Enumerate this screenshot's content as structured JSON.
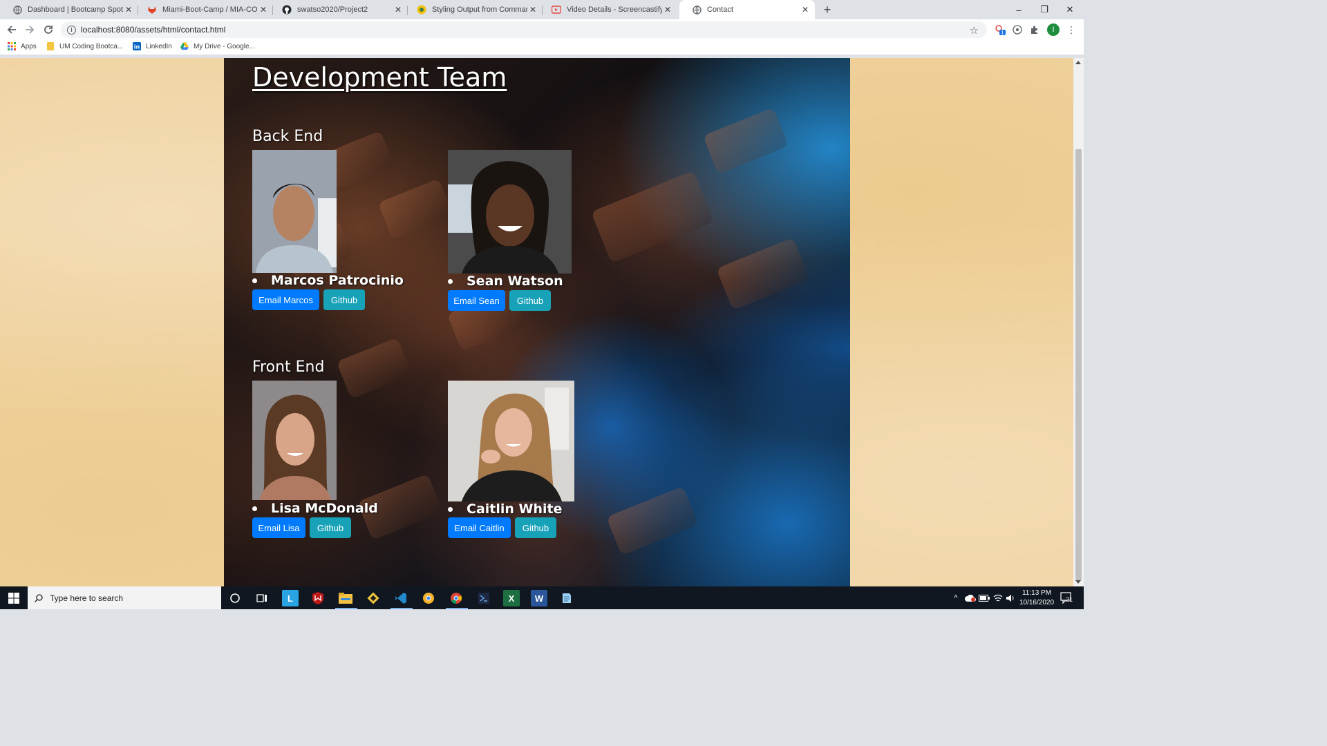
{
  "browser": {
    "tabs": [
      {
        "title": "Dashboard | Bootcamp Spot",
        "icon": "globe-icon",
        "active": false
      },
      {
        "title": "Miami-Boot-Camp / MIA-COG-FS",
        "icon": "gitlab-icon",
        "active": false
      },
      {
        "title": "swatso2020/Project2",
        "icon": "github-icon",
        "active": false
      },
      {
        "title": "Styling Output from Command-line",
        "icon": "extension-icon",
        "active": false
      },
      {
        "title": "Video Details - Screencastify",
        "icon": "screencastify-icon",
        "active": false
      },
      {
        "title": "Contact",
        "icon": "globe-icon",
        "active": true
      }
    ],
    "address": {
      "url": "localhost:8080/assets/html/contact.html"
    },
    "bookmarks": [
      {
        "label": "Apps",
        "icon": "apps-grid-icon"
      },
      {
        "label": "UM Coding Bootca...",
        "icon": "folder-icon"
      },
      {
        "label": "LinkedIn",
        "icon": "linkedin-icon"
      },
      {
        "label": "My Drive - Google...",
        "icon": "google-drive-icon"
      }
    ],
    "profile_initial": "I",
    "extension_badge": "1"
  },
  "page": {
    "title": "Development Team",
    "sections": [
      {
        "heading": "Back End",
        "members": [
          {
            "name": "Marcos Patrocinio",
            "email_label": "Email Marcos",
            "github_label": "Github"
          },
          {
            "name": "Sean Watson",
            "email_label": "Email Sean",
            "github_label": "Github"
          }
        ]
      },
      {
        "heading": "Front End",
        "members": [
          {
            "name": "Lisa McDonald",
            "email_label": "Email Lisa",
            "github_label": "Github"
          },
          {
            "name": "Caitlin White",
            "email_label": "Email Caitlin",
            "github_label": "Github"
          }
        ]
      }
    ]
  },
  "taskbar": {
    "search_placeholder": "Type here to search",
    "time": "11:13 PM",
    "date": "10/16/2020",
    "notification_count": "21",
    "apps": [
      "cortana-icon",
      "task-view-icon",
      "lucidchart-icon",
      "mcafee-icon",
      "file-explorer-icon",
      "git-icon",
      "vscode-icon",
      "chrome-canary-icon",
      "chrome-icon",
      "visual-studio-icon",
      "excel-icon",
      "word-icon",
      "notepad-icon"
    ]
  },
  "colors": {
    "email_button": "#007bff",
    "github_button": "#17a2b8",
    "page_background": "#efd29f",
    "taskbar": "#101720"
  }
}
